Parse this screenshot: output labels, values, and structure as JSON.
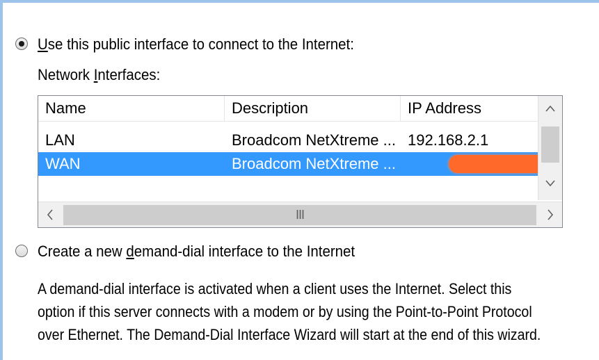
{
  "option_public": {
    "label_pre": "",
    "label_accel": "U",
    "label_post": "se this public interface to connect to the Internet:",
    "selected": true
  },
  "network_interfaces": {
    "label_pre": "Network ",
    "label_accel": "I",
    "label_post": "nterfaces:",
    "columns": [
      "Name",
      "Description",
      "IP Address"
    ],
    "rows": [
      {
        "name": "LAN",
        "description": "Broadcom NetXtreme ...",
        "ip": "192.168.2.1",
        "selected": false
      },
      {
        "name": "WAN",
        "description": "Broadcom NetXtreme ...",
        "ip": "",
        "selected": true,
        "ip_redacted": true
      }
    ],
    "scroll_up_icon": "chevron-up",
    "scroll_down_icon": "chevron-down",
    "scroll_left_icon": "chevron-left",
    "scroll_right_icon": "chevron-right",
    "h_thumb_grip": "III"
  },
  "option_demand_dial": {
    "label_pre": "Create a new ",
    "label_accel": "d",
    "label_post": "emand-dial interface to the Internet",
    "selected": false
  },
  "description": {
    "line1": "A demand-dial interface is activated when a client uses the Internet. Select this",
    "line2": "option if this server connects with a modem or by using the Point-to-Point Protocol",
    "line3": "over Ethernet. The Demand-Dial Interface Wizard will start at the end of this wizard."
  },
  "colors": {
    "selection": "#3399ff",
    "redaction": "#ff6a2a",
    "frame": "#9ec3ea"
  }
}
